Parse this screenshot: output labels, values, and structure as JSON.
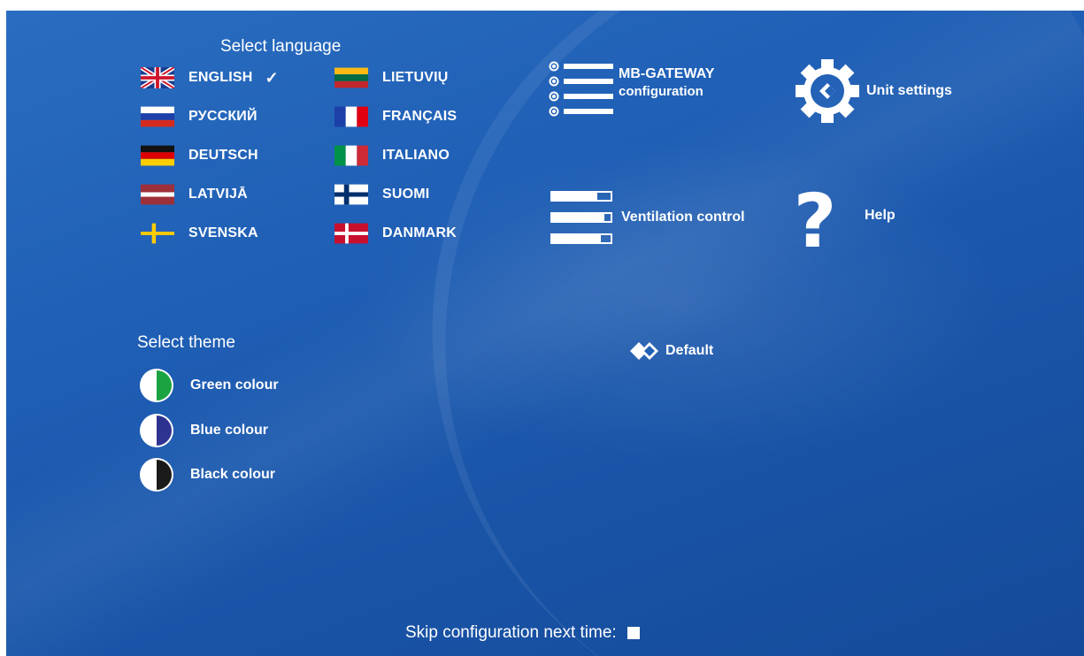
{
  "language": {
    "heading": "Select language",
    "selected_mark": "✓",
    "items": [
      {
        "label": "ENGLISH",
        "flag": "uk-flag-icon",
        "selected": true
      },
      {
        "label": "РУССКИЙ",
        "flag": "russia-flag-icon"
      },
      {
        "label": "DEUTSCH",
        "flag": "germany-flag-icon"
      },
      {
        "label": "LATVIJĀ",
        "flag": "latvia-flag-icon"
      },
      {
        "label": "SVENSKA",
        "flag": "sweden-flag-icon"
      },
      {
        "label": "LIETUVIŲ",
        "flag": "lithuania-flag-icon"
      },
      {
        "label": "FRANÇAIS",
        "flag": "france-flag-icon"
      },
      {
        "label": "ITALIANO",
        "flag": "italy-flag-icon"
      },
      {
        "label": "SUOMI",
        "flag": "finland-flag-icon"
      },
      {
        "label": "DANMARK",
        "flag": "denmark-flag-icon"
      }
    ]
  },
  "theme": {
    "heading": "Select theme",
    "items": [
      {
        "label": "Green colour",
        "color": "#1aa340"
      },
      {
        "label": "Blue colour",
        "color": "#2b2f8f"
      },
      {
        "label": "Black colour",
        "color": "#111111"
      }
    ]
  },
  "menu": {
    "gateway_line1": "MB-GATEWAY",
    "gateway_line2": "configuration",
    "unit_settings": "Unit settings",
    "ventilation": "Ventilation control",
    "help": "Help",
    "help_glyph": "?",
    "default_theme": "Default"
  },
  "footer": {
    "skip_label": "Skip configuration next time:"
  },
  "colors": {
    "background": "#1f5fb5",
    "text": "#ffffff"
  }
}
